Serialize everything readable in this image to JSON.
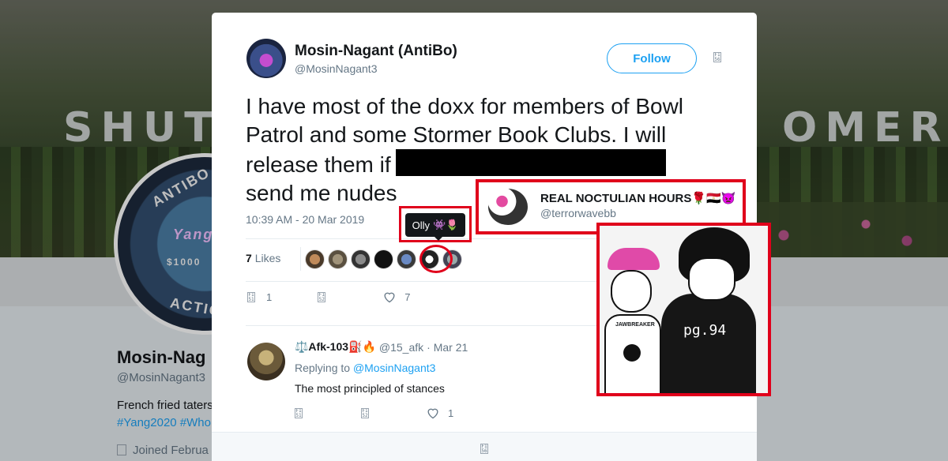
{
  "background": {
    "banner_left": "SHUT",
    "banner_right": "OMER",
    "avatar_ring_top": "ANTIBO",
    "avatar_ring_bottom": "ACTIO",
    "avatar_mid": "Yang",
    "avatar_price": "$1000",
    "name": "Mosin-Nag",
    "handle": "@MosinNagant3",
    "bio": "French fried taters",
    "tags": "#Yang2020 #Who",
    "joined": "Joined Februa"
  },
  "tweet": {
    "name": "Mosin-Nagant (AntiBo)",
    "handle": "@MosinNagant3",
    "follow_label": "Follow",
    "text_line1": "I have most of the doxx for members of Bowl",
    "text_line2": "Patrol and some Stormer Book Clubs. I will",
    "text_line3": "release them if",
    "text_line4": "send me nudes",
    "timestamp": "10:39 AM - 20 Mar 2019",
    "likes_count": "7",
    "likes_label": "Likes",
    "reply_count": "1",
    "like_action_count": "7",
    "tooltip_name": "Olly",
    "tooltip_emoji": "👾🌷"
  },
  "reply": {
    "name": "⚖️Afk-103",
    "name_emoji": "⛽🔥",
    "handle": "@15_afk",
    "date": "· Mar 21",
    "replying_prefix": "Replying to",
    "replying_to": "@MosinNagant3",
    "text": "The most principled of stances",
    "like_count": "1"
  },
  "user_card": {
    "name": "REAL NOCTULIAN HOURS🌹🇪🇬👿",
    "handle": "@terrorwavebb"
  },
  "image": {
    "shirt_text": "JAWBREAKER",
    "jacket_text": "pg.94"
  },
  "colors": {
    "accent": "#1da1f2",
    "annotation_red": "#e0001b"
  }
}
